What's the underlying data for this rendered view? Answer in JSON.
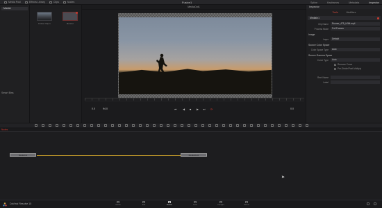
{
  "topbar": {
    "left_tabs": [
      "Media Pool",
      "Effects Library",
      "Clips",
      "Nodes"
    ],
    "title": "Fusion1",
    "right_tabs": [
      "Spline",
      "Keyframes",
      "Metadata",
      "Inspector"
    ]
  },
  "leftpane": {
    "folder": "Master",
    "smart_bins": "Smart Bins"
  },
  "mediapool": {
    "thumbs": [
      "Fusion Clip 1",
      "Runner"
    ]
  },
  "viewer": {
    "title": "MediaOut1",
    "timecode_start": "0.0",
    "timecode_end": "94.0",
    "frame": "0.0"
  },
  "inspector": {
    "header": "Inspector",
    "tabs": [
      "Tools",
      "Modifiers"
    ],
    "node_name": "MediaIn1",
    "fields": {
      "clip_name_label": "Clip Name",
      "clip_name": "Runner_475_h264.mp4",
      "process_mode_label": "Process Mode",
      "process_mode": "Full Frames",
      "image_section": "Image",
      "layer_label": "Layer",
      "layer": "Default",
      "source_color_section": "Source Color Space",
      "color_space_label": "Color Space Type",
      "color_space": "Auto",
      "source_gamma_section": "Source Gamma Space",
      "curve_type_label": "Curve Type",
      "curve_type": "Auto",
      "remove_curve": "Remove Curve",
      "pre_divide": "Pre-Divide/Post-Multiply",
      "reel_label": "Reel Name",
      "label_label": "Label"
    }
  },
  "nodes": {
    "header": "Nodes",
    "node_in": "MediaIn1",
    "node_out": "MediaOut1"
  },
  "bottombar": {
    "app": "DaVinci Resolve 15",
    "pages": [
      "Media",
      "Edit",
      "Fusion",
      "Color",
      "Fairlight",
      "Deliver"
    ]
  }
}
